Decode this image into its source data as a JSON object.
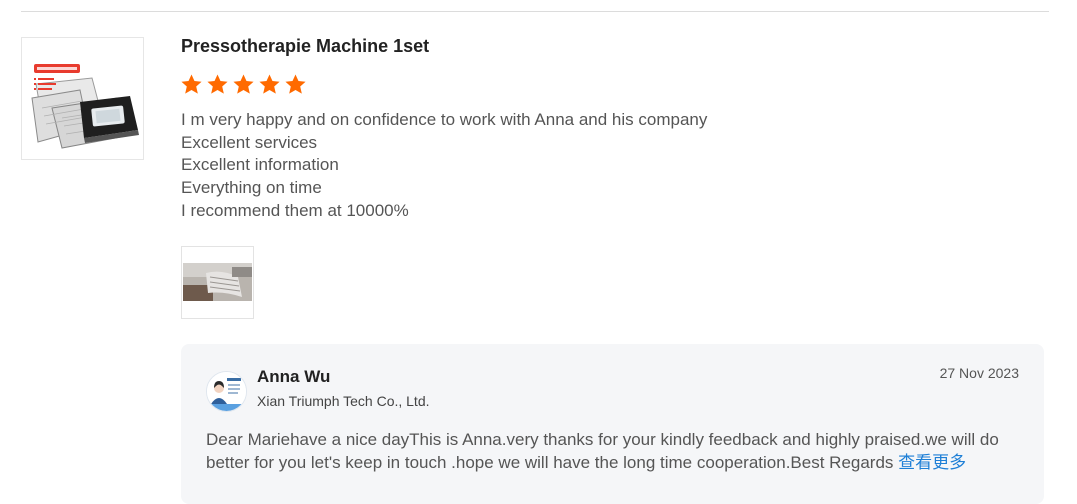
{
  "review": {
    "title": "Pressotherapie Machine 1set",
    "rating": 5,
    "rating_max": 5,
    "star_color": "#ff6a00",
    "product_image_label": "air pressotherapy suit",
    "lines": [
      "I m very happy and on confidence to work with Anna and his company",
      "Excellent services",
      "Excellent information",
      "Everything on time",
      "I recommend them at 10000%"
    ]
  },
  "reply": {
    "name": "Anna Wu",
    "company": "Xian Triumph Tech Co., Ltd.",
    "date": "27 Nov 2023",
    "lines": [
      "Dear Mariehave a nice dayThis is Anna.very thanks for your kindly feedback and highly praised.we will do",
      "better for you let's keep in touch .hope we will have the long time cooperation.Best Regards"
    ],
    "view_more": "查看更多",
    "link_color": "#1e7fd6"
  }
}
